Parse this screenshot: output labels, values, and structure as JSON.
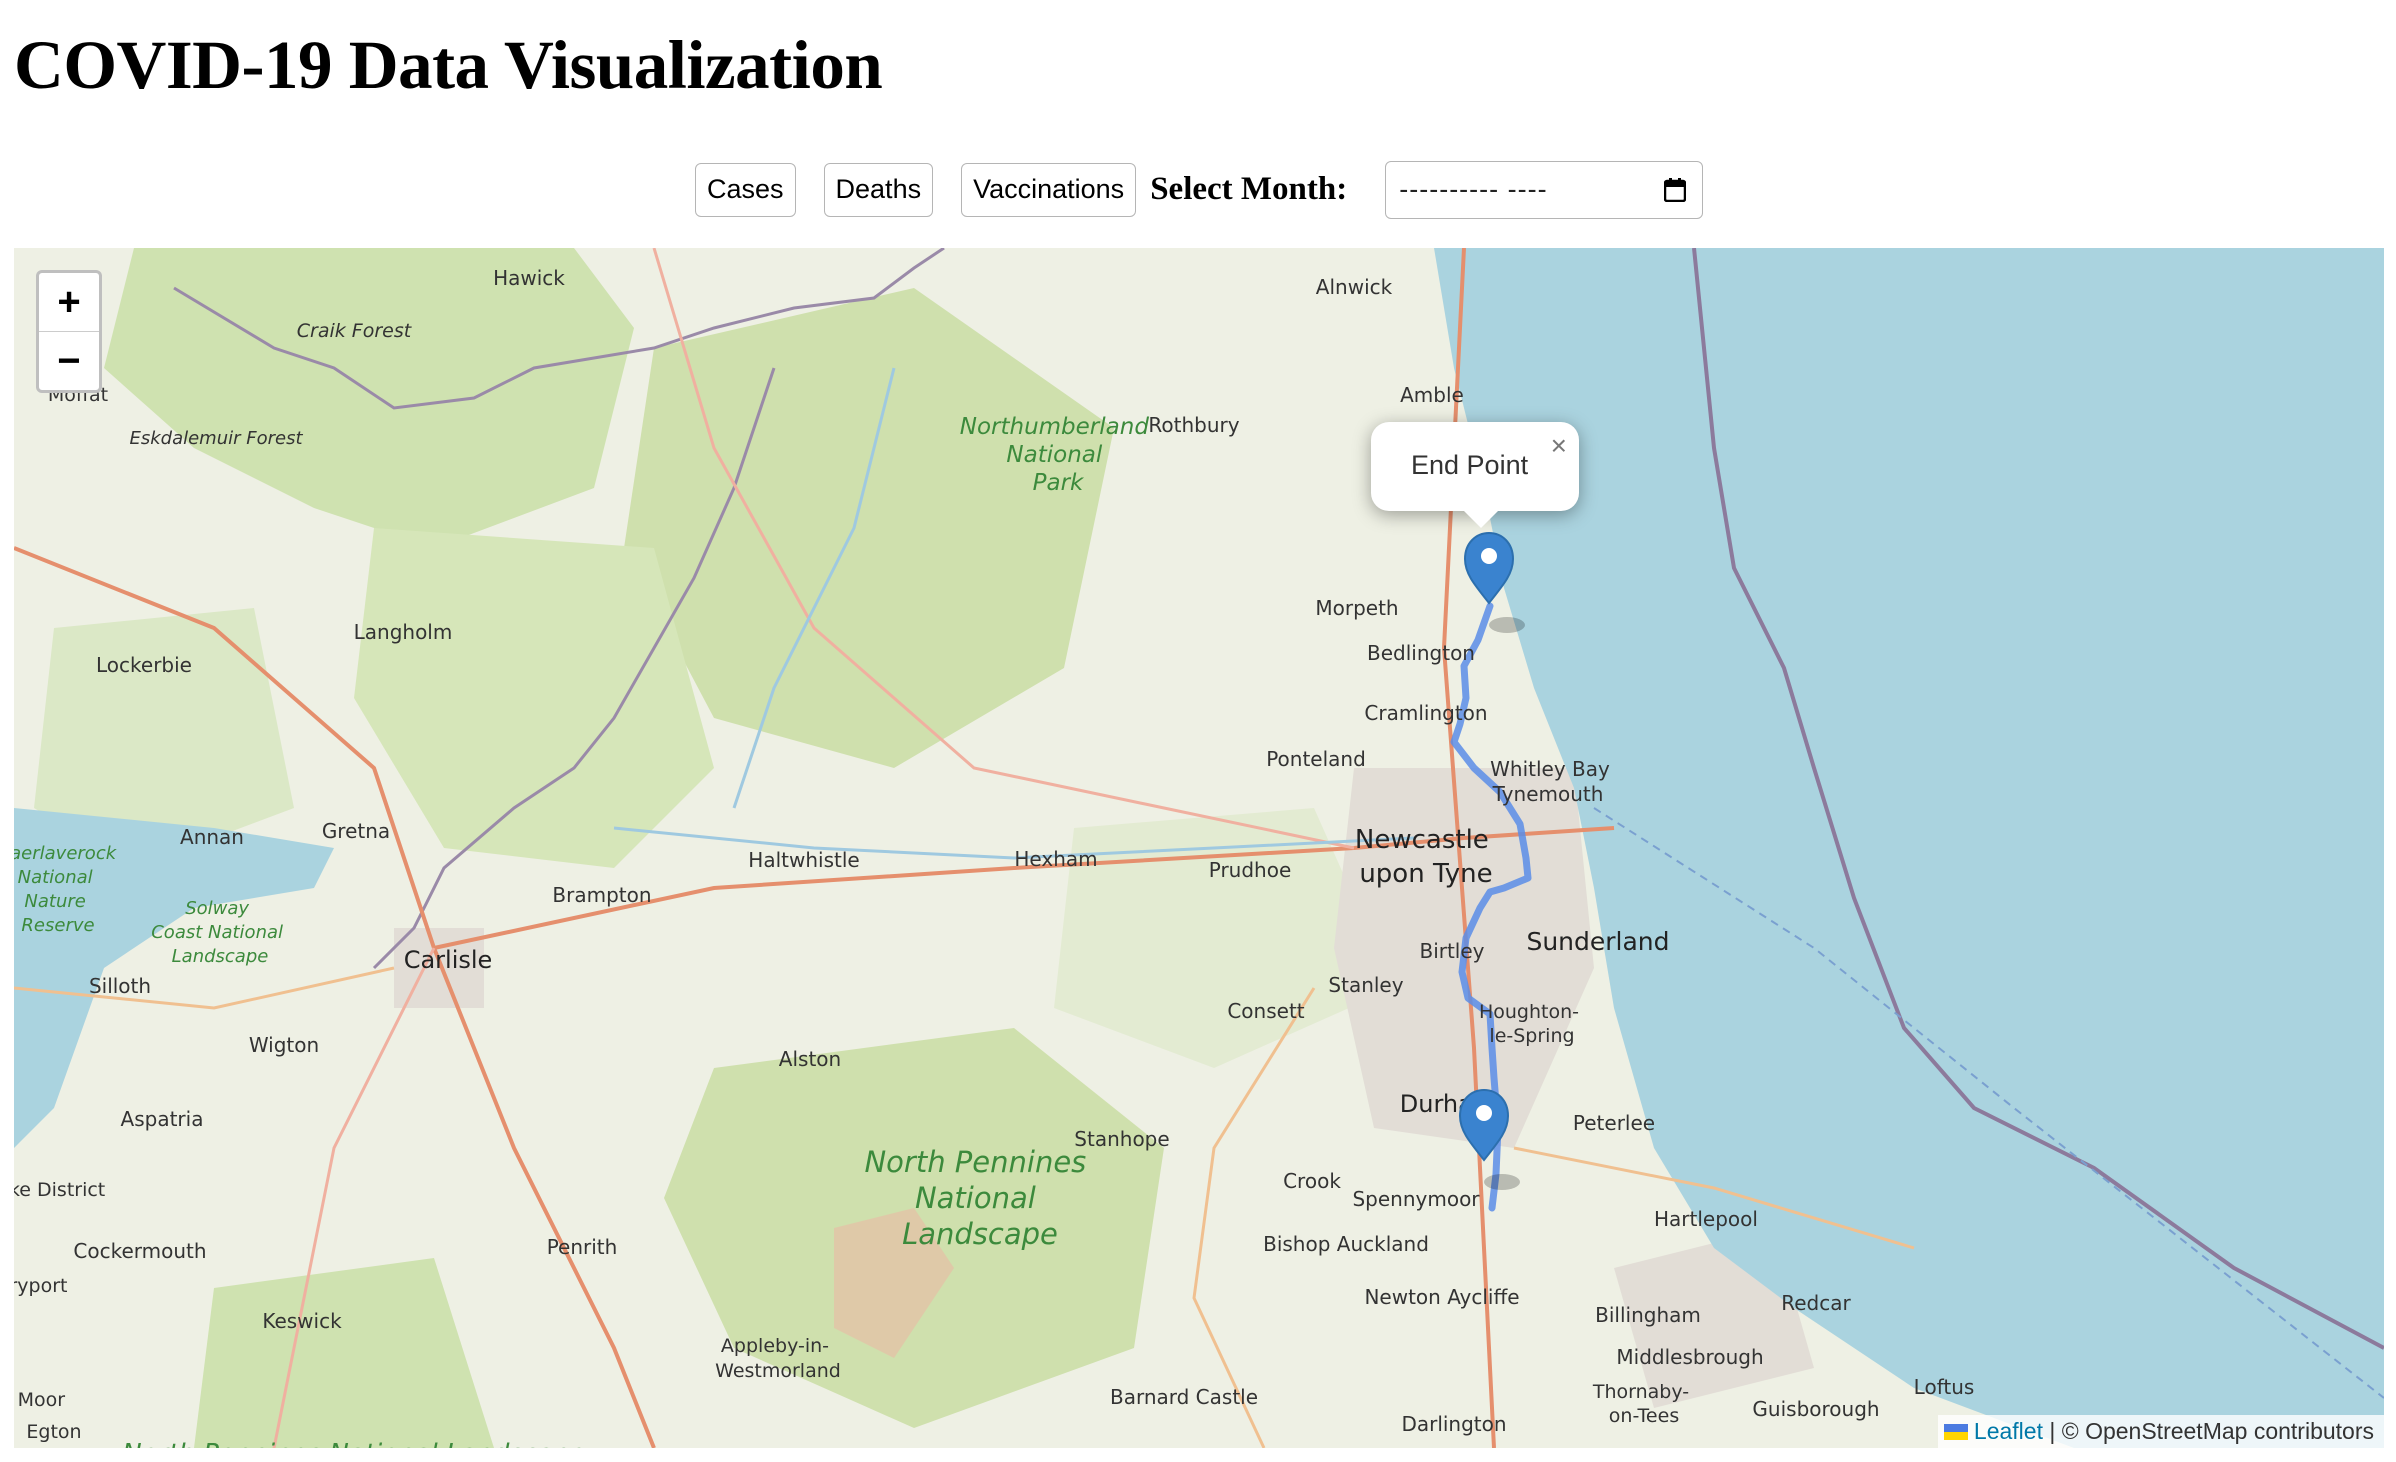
{
  "page_title": "COVID-19 Data Visualization",
  "controls": {
    "buttons": [
      "Cases",
      "Deaths",
      "Vaccinations"
    ],
    "select_month_label": "Select Month:",
    "date_value": "---------- ----"
  },
  "map": {
    "zoom_in": "+",
    "zoom_out": "−",
    "popup": {
      "text": "End Point",
      "close": "×"
    },
    "attribution": {
      "leaflet": "Leaflet",
      "separator": " | ",
      "osm": "© OpenStreetMap contributors"
    },
    "colors": {
      "route": "#5b8de8",
      "marker": "#3a83cf",
      "sea": "#aad3df"
    },
    "places": [
      "Hawick",
      "Alnwick",
      "Craik Forest",
      "Moffat",
      "Eskdalemuir Forest",
      "Amble",
      "Rothbury",
      "Morpeth",
      "Langholm",
      "Lockerbie",
      "Bedlington",
      "Cramlington",
      "Ponteland",
      "Whitley Bay",
      "Tynemouth",
      "Annan",
      "Gretna",
      "Haltwhistle",
      "Hexham",
      "Prudhoe",
      "Newcastle upon Tyne",
      "Brampton",
      "Carlisle",
      "Sunderland",
      "Birtley",
      "Stanley",
      "Consett",
      "Houghton-le-Spring",
      "Silloth",
      "Wigton",
      "Alston",
      "Durham",
      "Peterlee",
      "Aspatria",
      "Stanhope",
      "Crook",
      "Spennymoor",
      "Hartlepool",
      "Cockermouth",
      "Penrith",
      "Bishop Auckland",
      "Newton Aycliffe",
      "Redcar",
      "Billingham",
      "Keswick",
      "Appleby-in-Westmorland",
      "Middlesbrough",
      "Thornaby-on-Tees",
      "Guisborough",
      "Loftus",
      "Barnard Castle",
      "Darlington",
      "Caerlaverock National Nature Reserve",
      "Solway Coast National Landscape",
      "Northumberland National Park",
      "North Pennines National Landscape",
      "Lake District",
      "Aryport",
      "Egton",
      "Cor Moor",
      "En"
    ]
  }
}
